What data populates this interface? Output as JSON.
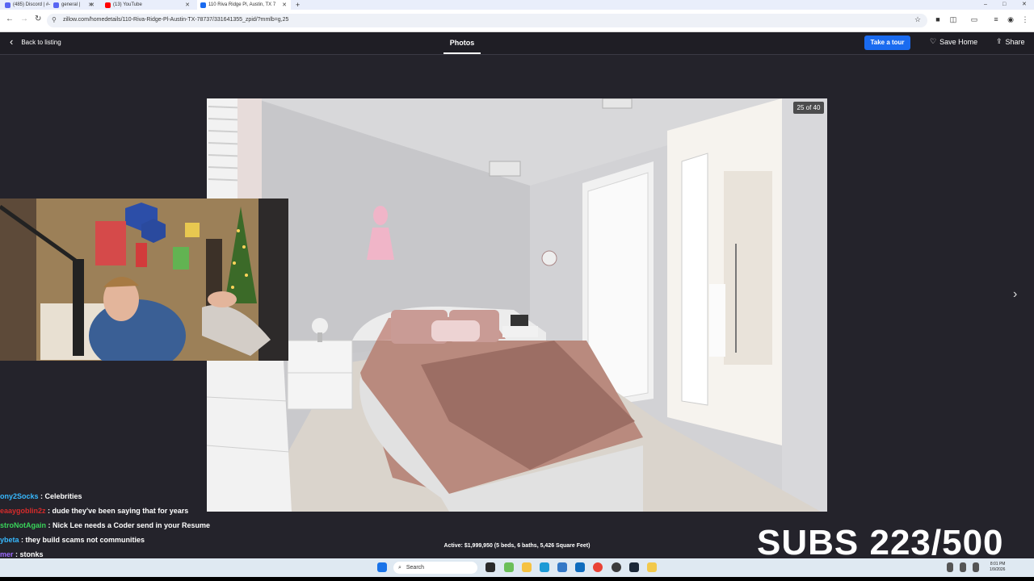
{
  "browser": {
    "tabs": [
      {
        "label": "(485) Discord | #-",
        "favicon_color": "#5865f2",
        "active": false
      },
      {
        "label": "general |",
        "favicon_color": "#5865f2",
        "active": false
      },
      {
        "label": "(13) YouTube",
        "favicon_color": "#ff0000",
        "active": false
      },
      {
        "label": "110 Riva Ridge Pl, Austin, TX 7",
        "favicon_color": "#1a6bf0",
        "active": true
      }
    ],
    "url": "zillow.com/homedetails/110-Riva-Ridge-Pl-Austin-TX-78737/331641355_zpid/?mmlb=g,25"
  },
  "header": {
    "back_label": "Back to listing",
    "photos_tab": "Photos",
    "tour_button": "Take a tour",
    "save_label": "Save Home",
    "share_label": "Share"
  },
  "photo": {
    "counter": "25 of 40",
    "caption": "Active: $1,999,950 (5 beds, 6 baths, 5,426 Square Feet)"
  },
  "chat": {
    "messages": [
      {
        "user": "ony2Socks",
        "user_color": "#37b9ff",
        "text": " : Celebrities"
      },
      {
        "user": "eaaygoblin2z",
        "user_color": "#d62b2b",
        "text": " : dude they've been saying that for years"
      },
      {
        "user": "stroNotAgain",
        "user_color": "#39d35a",
        "text": " : Nick Lee needs a Coder send in your Resume"
      },
      {
        "user": "ybeta",
        "user_color": "#37b9ff",
        "text": " : they build scams not communities"
      },
      {
        "user": "mer",
        "user_color": "#9b6bff",
        "text": " : stonks"
      }
    ]
  },
  "overlay": {
    "subs": "SUBS 223/500"
  },
  "taskbar": {
    "search_label": "Search",
    "time": "8:01 PM",
    "date": "1/9/2026"
  }
}
